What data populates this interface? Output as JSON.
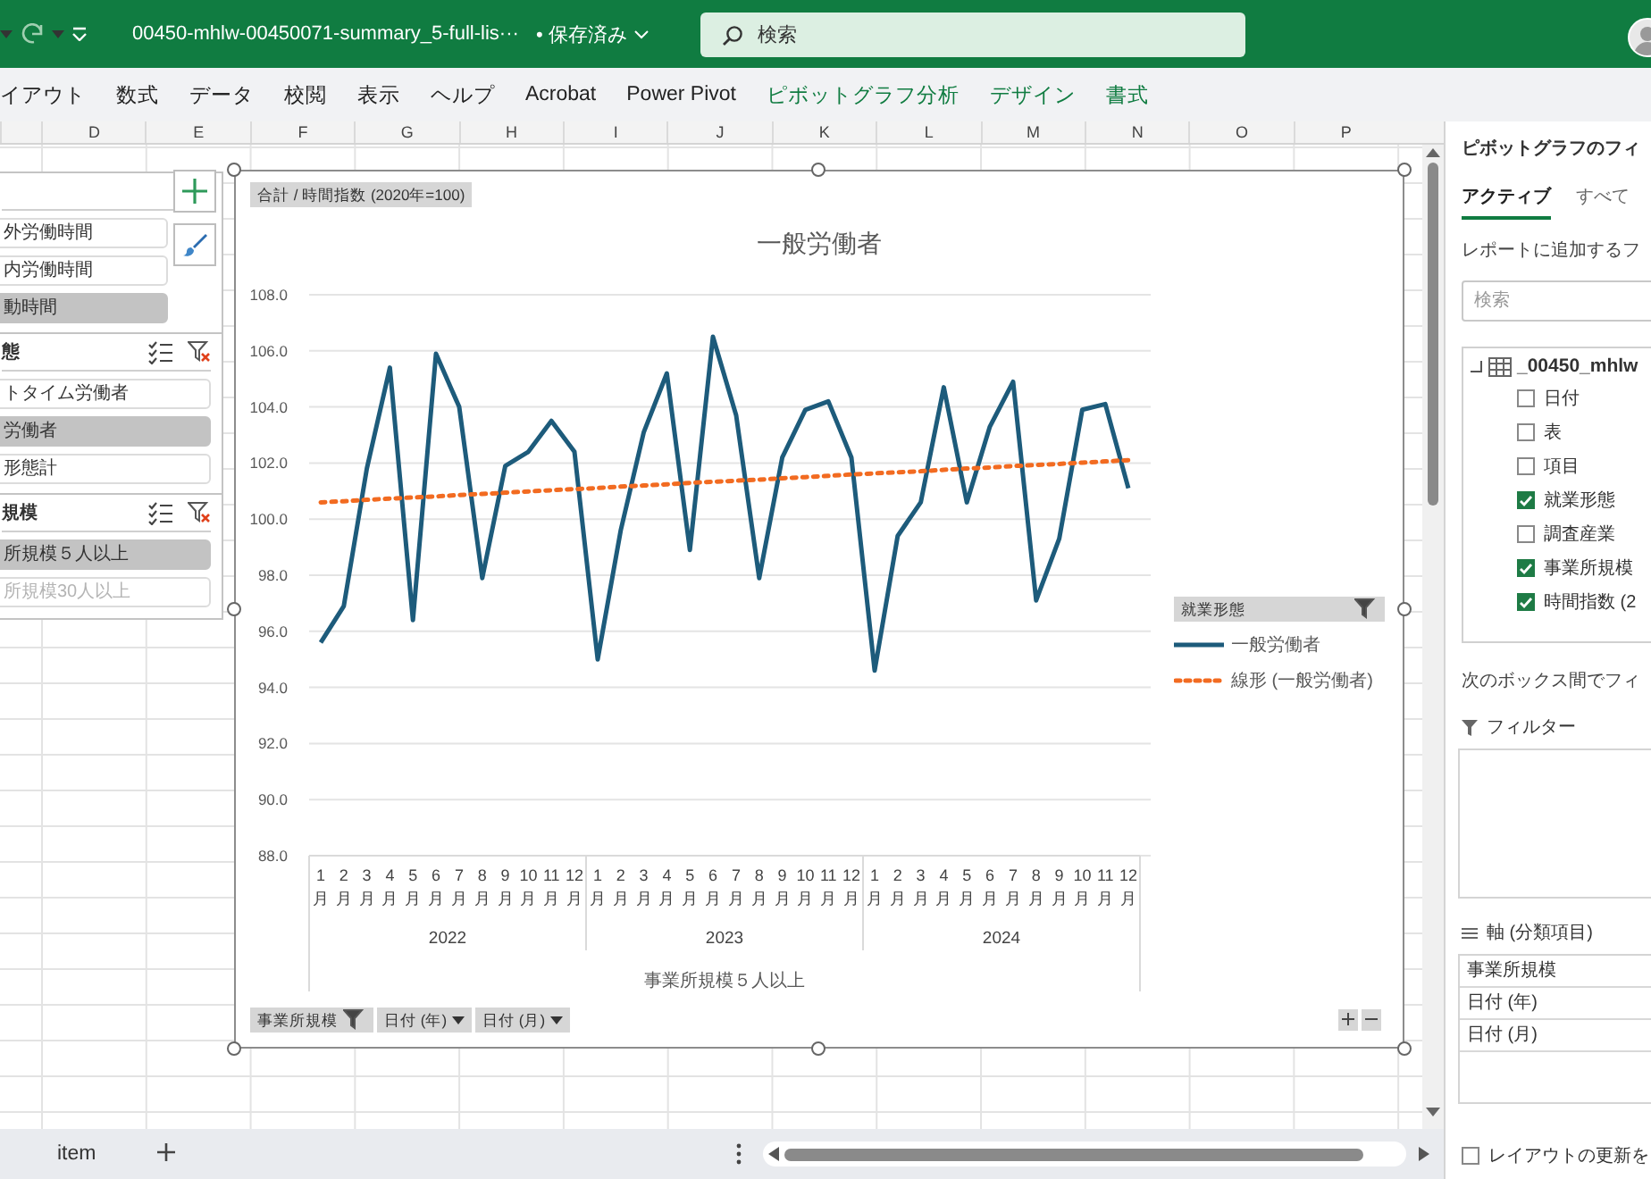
{
  "title_bar": {
    "filename": "00450-mhlw-00450071-summary_5-full-lis···",
    "save_status": "• 保存済み",
    "search": {
      "placeholder": "検索"
    }
  },
  "ribbon_tabs": [
    {
      "label": "イアウト",
      "kind": "standard"
    },
    {
      "label": "数式",
      "kind": "standard"
    },
    {
      "label": "データ",
      "kind": "standard"
    },
    {
      "label": "校閲",
      "kind": "standard"
    },
    {
      "label": "表示",
      "kind": "standard"
    },
    {
      "label": "ヘルプ",
      "kind": "standard"
    },
    {
      "label": "Acrobat",
      "kind": "standard"
    },
    {
      "label": "Power Pivot",
      "kind": "standard"
    },
    {
      "label": "ピボットグラフ分析",
      "kind": "contextual"
    },
    {
      "label": "デザイン",
      "kind": "contextual"
    },
    {
      "label": "書式",
      "kind": "contextual"
    }
  ],
  "column_headers": [
    "D",
    "E",
    "F",
    "G",
    "H",
    "I",
    "J",
    "K",
    "L",
    "M",
    "N",
    "O",
    "P"
  ],
  "slicers": [
    {
      "filter_button": false,
      "items": [
        {
          "label": "外労働時間",
          "selected": false,
          "disabled": false
        },
        {
          "label": "内労働時間",
          "selected": false,
          "disabled": false
        },
        {
          "label": "動時間",
          "selected": true,
          "disabled": false
        }
      ]
    },
    {
      "header": "態",
      "filter_button": true,
      "items": [
        {
          "label": "トタイム労働者",
          "selected": false,
          "disabled": false
        },
        {
          "label": "労働者",
          "selected": true,
          "disabled": false
        },
        {
          "label": "形態計",
          "selected": false,
          "disabled": false
        }
      ]
    },
    {
      "header": "規模",
      "filter_button": true,
      "items": [
        {
          "label": "所規模５人以上",
          "selected": true,
          "disabled": false
        },
        {
          "label": "所規模30人以上",
          "selected": false,
          "disabled": true
        }
      ]
    }
  ],
  "pivot_chart": {
    "value_field_button": "合計 / 時間指数 (2020年=100)",
    "chart_data": {
      "type": "line",
      "title": "一般労働者",
      "categories": [
        "1月",
        "2月",
        "3月",
        "4月",
        "5月",
        "6月",
        "7月",
        "8月",
        "9月",
        "10月",
        "11月",
        "12月",
        "1月",
        "2月",
        "3月",
        "4月",
        "5月",
        "6月",
        "7月",
        "8月",
        "9月",
        "10月",
        "11月",
        "12月",
        "1月",
        "2月",
        "3月",
        "4月",
        "5月",
        "6月",
        "7月",
        "8月",
        "9月",
        "10月",
        "11月",
        "12月"
      ],
      "grid": true,
      "legend": true,
      "series": [
        {
          "name": "一般労働者",
          "line_style": "solid",
          "color": "#1d5b7b",
          "values": [
            95.6,
            96.9,
            101.8,
            105.4,
            96.4,
            105.9,
            104.0,
            97.9,
            101.9,
            102.4,
            103.5,
            102.4,
            95.0,
            99.6,
            103.1,
            105.2,
            98.9,
            106.5,
            103.7,
            97.9,
            102.2,
            103.9,
            104.2,
            102.2,
            94.6,
            99.4,
            100.6,
            104.7,
            100.6,
            103.3,
            104.9,
            97.1,
            99.3,
            103.9,
            104.1,
            101.1
          ]
        },
        {
          "name": "線形 (一般労働者)",
          "line_style": "dotted",
          "color": "#f26b21",
          "values": [
            100.6,
            100.64,
            100.69,
            100.73,
            100.77,
            100.81,
            100.86,
            100.9,
            100.94,
            100.99,
            101.03,
            101.07,
            101.11,
            101.16,
            101.2,
            101.24,
            101.29,
            101.33,
            101.37,
            101.41,
            101.46,
            101.5,
            101.54,
            101.59,
            101.63,
            101.67,
            101.71,
            101.76,
            101.8,
            101.84,
            101.89,
            101.93,
            101.97,
            102.01,
            102.06,
            102.1
          ]
        }
      ],
      "ylim": [
        88,
        108
      ],
      "yticks": [
        {
          "value": 88,
          "label": "88.0"
        },
        {
          "value": 90,
          "label": "90.0"
        },
        {
          "value": 92,
          "label": "92.0"
        },
        {
          "value": 94,
          "label": "94.0"
        },
        {
          "value": 96,
          "label": "96.0"
        },
        {
          "value": 98,
          "label": "98.0"
        },
        {
          "value": 100,
          "label": "100.0"
        },
        {
          "value": 102,
          "label": "102.0"
        },
        {
          "value": 104,
          "label": "104.0"
        },
        {
          "value": 106,
          "label": "106.0"
        },
        {
          "value": 108,
          "label": "108.0"
        }
      ]
    },
    "category_groups": [
      "2022",
      "2023",
      "2024"
    ],
    "axis_caption": "事業所規模５人以上",
    "legend_field_button": "就業形態",
    "axis_field_buttons": [
      {
        "label": "事業所規模",
        "filtered": true
      },
      {
        "label": "日付 (年)",
        "filtered": false
      },
      {
        "label": "日付 (月)",
        "filtered": false
      }
    ]
  },
  "sheet_tabs": [
    {
      "label": "item",
      "selected": false
    }
  ],
  "field_pane": {
    "title": "ピボットグラフのフィ",
    "tabs": [
      {
        "label": "アクティブ",
        "selected": true
      },
      {
        "label": "すべて",
        "selected": false
      }
    ],
    "add_prompt": "レポートに追加するフ",
    "search": {
      "placeholder": "検索"
    },
    "table": {
      "name": "_00450_mhlw",
      "expanded": true,
      "children": [
        {
          "label": "日付",
          "checked": false
        },
        {
          "label": "表",
          "checked": false
        },
        {
          "label": "項目",
          "checked": false
        },
        {
          "label": "就業形態",
          "checked": true
        },
        {
          "label": "調査産業",
          "checked": false
        },
        {
          "label": "事業所規模",
          "checked": true
        },
        {
          "label": "時間指数 (2",
          "checked": true
        }
      ]
    },
    "drag_prompt": "次のボックス間でフィ",
    "areas": [
      {
        "kind": "filter",
        "label": "フィルター"
      },
      {
        "kind": "axis",
        "label": "軸 (分類項目)",
        "items": [
          "事業所規模",
          "日付 (年)",
          "日付 (月)"
        ]
      }
    ],
    "defer_update": {
      "label": "レイアウトの更新を",
      "checked": false
    }
  }
}
